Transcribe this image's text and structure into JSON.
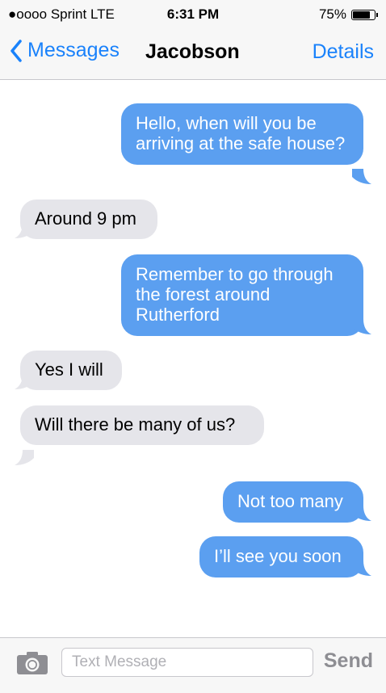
{
  "status_bar": {
    "signal": "●oooo",
    "carrier": "Sprint",
    "network": "LTE",
    "time": "6:31 PM",
    "battery_text": "75%",
    "battery_level": 0.75
  },
  "nav": {
    "back_label": "Messages",
    "title": "Jacobson",
    "details_label": "Details"
  },
  "messages": [
    {
      "direction": "outgoing",
      "text": "Hello, when will you be arriving at the safe house?"
    },
    {
      "direction": "incoming",
      "text": "Around 9 pm"
    },
    {
      "direction": "outgoing",
      "text": "Remember to go through the forest around Rutherford"
    },
    {
      "direction": "incoming",
      "text": "Yes I will"
    },
    {
      "direction": "incoming",
      "text": "Will there be many of us?"
    },
    {
      "direction": "outgoing",
      "text": "Not too many"
    },
    {
      "direction": "outgoing",
      "text": "I’ll see you soon"
    }
  ],
  "input": {
    "placeholder": "Text Message",
    "value": "",
    "send_label": "Send",
    "camera_icon": "camera-icon"
  },
  "colors": {
    "outgoing_bubble": "#5b9ff0",
    "incoming_bubble": "#e5e5ea",
    "accent": "#1a82fb"
  }
}
